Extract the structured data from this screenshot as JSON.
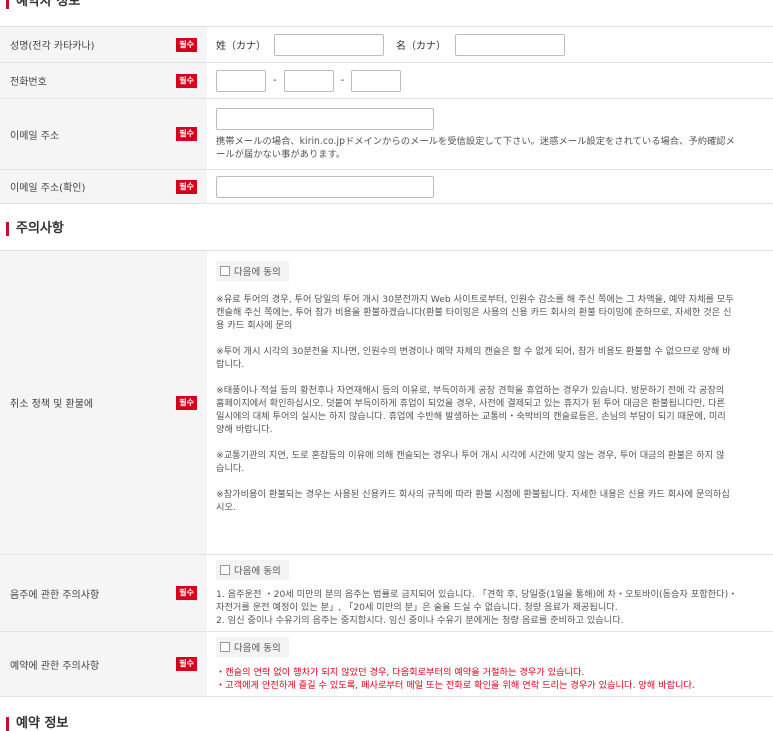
{
  "sections": {
    "reservation_info_title": "예약자 정보",
    "notes_title": "주의사항",
    "booking_info_title": "예약 정보"
  },
  "required_badge": "필수",
  "fields": {
    "name_label": "성명(전각 카타카나)",
    "family_name_label": "姓（カナ）",
    "given_name_label": "名（カナ）",
    "phone_label": "전화번호",
    "phone_separator": "-",
    "email_label": "이메일 주소",
    "email_note_line1": "携帯メールの場合、kirin.co.jpドメインからのメールを受信設定して下さい。迷惑メール設定をされている場合、予約確認メ",
    "email_note_line2": "ールが届かない事があります。",
    "email_confirm_label": "이메일 주소(확인)"
  },
  "notes": {
    "agree_label": "다음에 동의",
    "cancel": {
      "label": "취소 정책 및 환불에",
      "p1": "※유료 투어의 경우, 투어 당일의 투어 개시 30분전까지 Web 사이트로부터, 인원수 감소를 해 주신 쪽에는 그 차액을, 예약 자체를 모두\n캔슬해 주신 쪽에는, 투어 참가 비용을 환불하겠습니다(환불 타이밍은 사용의 신용 카드 회사의 환불 타이밍에 준하므로, 자세한 것은 신\n용 카드 회사에 문의",
      "p2": "※투어 개시 시각의 30분전을 지나면, 인원수의 변경이나 예약 자체의 캔슬은 할 수 없게 되어, 참가 비용도 환불할 수 없으므로 양해 바\n랍니다.",
      "p3": "※태풍이나 적설 등의 황천후나 자연재해시 등의 이유로, 부득이하게 공장 견학을 휴업하는 경우가 있습니다. 방문하기 전에 각 공장의\n홈페이지에서 확인하십시오. 덧붙여 부득이하게 휴업이 되었을 경우, 사전에 결제되고 있는 휴지가 된 투어 대금은 환불됩니다만, 다른\n일시에의 대체 투어의 실시는 하지 않습니다. 휴업에 수반해 발생하는 교통비・숙박비의 캔슬료등은, 손님의 부담이 되기 때문에, 미리\n양해 바랍니다.",
      "p4": "※교통기관의 지연, 도로 혼잡등의 이유에 의해 캔슬되는 경우나 투어 개시 시각에 시간에 맞지 않는 경우, 투어 대금의 환불은 하지 않\n습니다.",
      "p5": "※참가비용이 환불되는 경우는 사용된 신용카드 회사의 규칙에 따라 환불 시점에 환불됩니다. 자세한 내용은 신용 카드 회사에 문의하십\n시오."
    },
    "drinking": {
      "label": "음주에 관한 주의사항",
      "line1": "1. 음주운전 ・20세 미만의 분의 음주는 법률로 금지되어 있습니다. 「견학 후, 당일중(1일을 통해)에 차・오토바이(동승자 포함한다)・",
      "line2": "자전거를 운전 예정이 있는 분」, 「20세 미만의 분」은 술을 드실 수 없습니다. 청량 음료가 제공됩니다.",
      "line3": "2. 임신 중이나 수유기의 음주는 중지합시다. 임신 중이나 수유기 분에게는 청량 음료를 준비하고 있습니다."
    },
    "reservation": {
      "label": "예약에 관한 주의사항",
      "line1": "・캔슬의 연락 없이 행차가 되지 않았던 경우, 다음회로부터의 예약을 거절하는 경우가 있습니다.",
      "line2": "・고객에게 안전하게 즐길 수 있도록, 폐사로부터 메일 또는 전화로 확인을 위해 연락 드리는 경우가 있습니다. 양해 바랍니다."
    }
  },
  "colors": {
    "accent": "#c8102e",
    "required": "#d6001c",
    "warning_text": "#e3001b",
    "label_bg": "#f5f5f5"
  }
}
